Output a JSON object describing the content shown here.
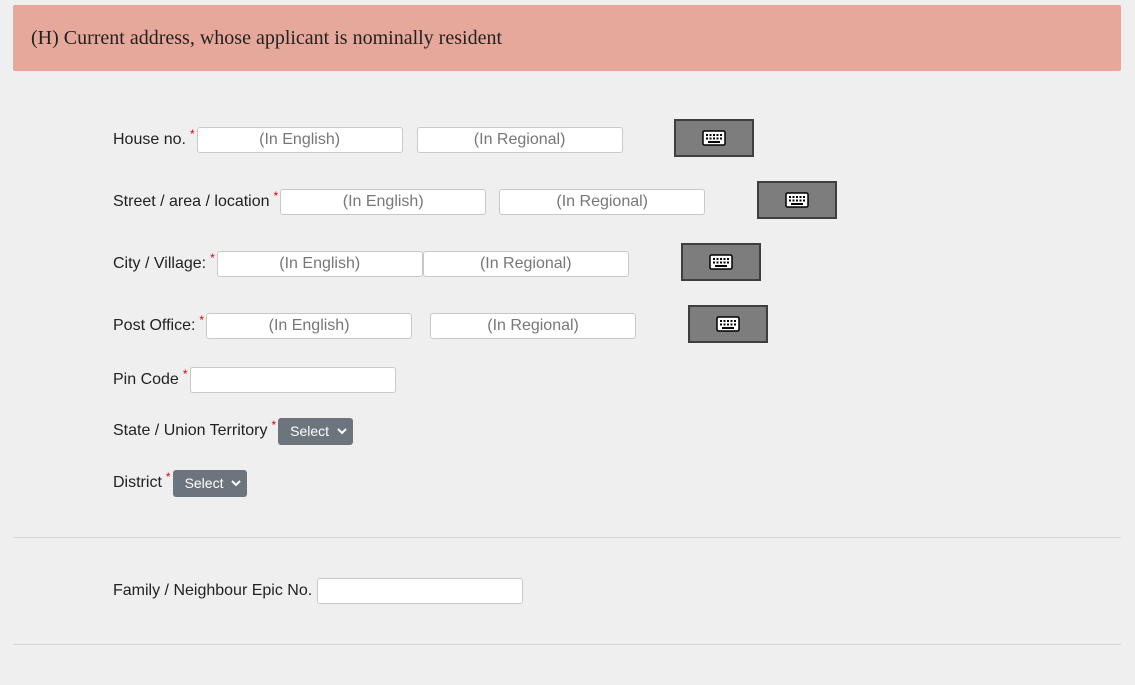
{
  "section": {
    "title": "(H) Current address, whose applicant is nominally resident"
  },
  "placeholders": {
    "english": "(In English)",
    "regional": "(In Regional)"
  },
  "required_mark": "*",
  "fields": {
    "house_no": {
      "label": "House no."
    },
    "street": {
      "label": "Street / area / location"
    },
    "city": {
      "label": "City / Village:"
    },
    "post_office": {
      "label": "Post Office:"
    },
    "pin_code": {
      "label": "Pin Code",
      "value": ""
    },
    "state": {
      "label": "State / Union Territory",
      "selected": "Select"
    },
    "district": {
      "label": "District",
      "selected": "Select"
    },
    "epic": {
      "label": "Family / Neighbour Epic No.",
      "value": ""
    }
  },
  "icons": {
    "keyboard": "keyboard-icon",
    "select_arrow": "chevron-down-icon"
  },
  "colors": {
    "header_bg": "#e6a89a",
    "required": "#e00000",
    "select_bg": "#6c757d",
    "keyboard_button_bg": "#7d7d7d"
  }
}
